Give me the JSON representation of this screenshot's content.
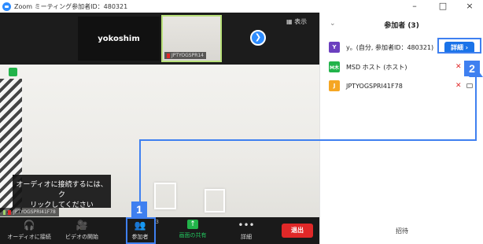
{
  "window": {
    "title": "Zoom ミーティング参加者ID：480321",
    "minimize_glyph": "–",
    "restore_glyph": "□",
    "close_glyph": "×"
  },
  "video": {
    "tile_name": "yokoshim",
    "self_label": "JPTYOGSPR14",
    "next_glyph": "❯",
    "view_label": "▦ 表示",
    "tooltip_line1": "オーディオに接続するには、ク",
    "tooltip_line2": "リックしてください",
    "name_bar": "JPTYOGSPRI41F78"
  },
  "toolbar": {
    "audio": {
      "icon": "headphones-icon",
      "glyph": "🎧",
      "label": "オーディオに接続"
    },
    "video": {
      "icon": "video-off-icon",
      "glyph": "🎥",
      "label": "ビデオの開始"
    },
    "participants": {
      "icon": "participants-icon",
      "glyph": "👥",
      "count": "3",
      "label": "参加者"
    },
    "share": {
      "icon": "share-screen-icon",
      "glyph": "↑",
      "label": "画面の共有"
    },
    "more": {
      "icon": "more-icon",
      "glyph": "•••",
      "label": "詳細"
    },
    "end_label": "退出",
    "caret": "^"
  },
  "panel": {
    "chevron": "⌄",
    "title": "参加者 (3)",
    "participants": [
      {
        "avatar": "Y",
        "color": "#6b3fbf",
        "name": "y。(自分, 参加者ID：480321)",
        "detail": "詳細 ›"
      },
      {
        "avatar": "M木",
        "color": "#22b34a",
        "name": "MSD ホスト (ホスト)"
      },
      {
        "avatar": "J",
        "color": "#f5a623",
        "name": "JPTYOGSPRI41F78"
      }
    ],
    "invite_label": "招待"
  },
  "annotations": {
    "badge1": "1",
    "badge2": "2",
    "accent": "#3f80f0"
  }
}
